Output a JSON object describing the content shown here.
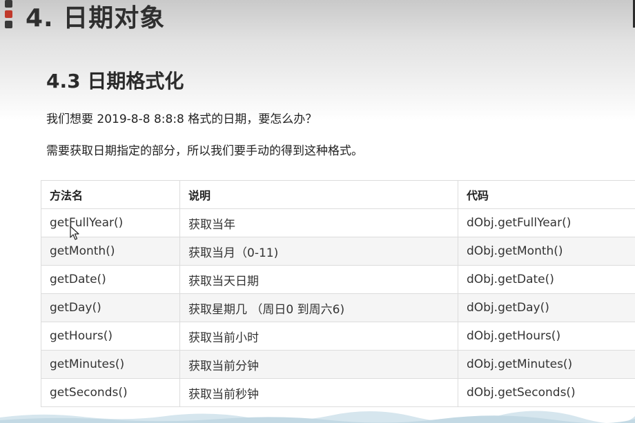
{
  "page": {
    "title": "4. 日期对象",
    "section_title": "4.3 日期格式化",
    "paragraphs": [
      "我们想要 2019-8-8  8:8:8 格式的日期，要怎么办？",
      "需要获取日期指定的部分，所以我们要手动的得到这种格式。"
    ]
  },
  "table": {
    "headers": [
      "方法名",
      "说明",
      "代码"
    ],
    "rows": [
      [
        "getFullYear()",
        "获取当年",
        "dObj.getFullYear()"
      ],
      [
        "getMonth()",
        "获取当月（0-11)",
        "dObj.getMonth()"
      ],
      [
        "getDate()",
        "获取当天日期",
        "dObj.getDate()"
      ],
      [
        "getDay()",
        "获取星期几 （周日0 到周六6)",
        "dObj.getDay()"
      ],
      [
        "getHours()",
        "获取当前小时",
        "dObj.getHours()"
      ],
      [
        "getMinutes()",
        "获取当前分钟",
        "dObj.getMinutes()"
      ],
      [
        "getSeconds()",
        "获取当前秒钟",
        "dObj.getSeconds()"
      ]
    ]
  },
  "colors": {
    "accent_marker": "#c0392b",
    "title_text": "#2f2f2f",
    "table_border": "#dcdcdc",
    "row_alt": "#f5f5f5",
    "wave": "#d6e6ee"
  },
  "icons": {
    "cursor": "mouse-pointer-icon"
  }
}
